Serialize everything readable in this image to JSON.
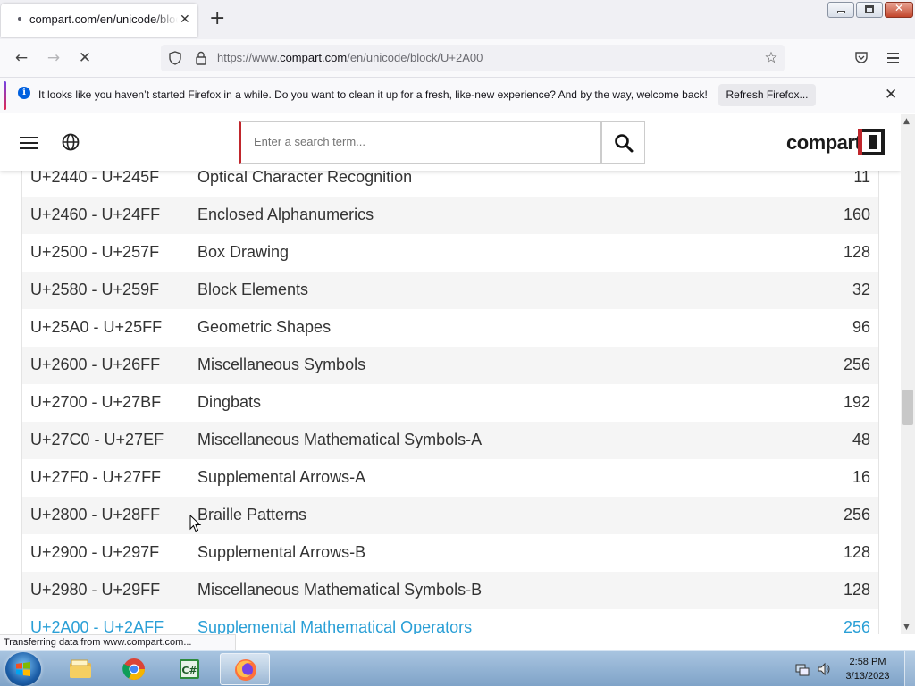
{
  "browser": {
    "tab_title": "compart.com/en/unicode/block/U+2A00",
    "url_prefix": "https://www.",
    "url_host": "compart.com",
    "url_path": "/en/unicode/block/U+2A00",
    "notification": "It looks like you haven’t started Firefox in a while. Do you want to clean it up for a fresh, like-new experience? And by the way, welcome back!",
    "refresh_label": "Refresh Firefox...",
    "status_text": "Transferring data from www.compart.com..."
  },
  "site": {
    "logo_text": "compart",
    "search_placeholder": "Enter a search term..."
  },
  "blocks": [
    {
      "range": "U+2440 - U+245F",
      "name": "Optical Character Recognition",
      "count": "11"
    },
    {
      "range": "U+2460 - U+24FF",
      "name": "Enclosed Alphanumerics",
      "count": "160"
    },
    {
      "range": "U+2500 - U+257F",
      "name": "Box Drawing",
      "count": "128"
    },
    {
      "range": "U+2580 - U+259F",
      "name": "Block Elements",
      "count": "32"
    },
    {
      "range": "U+25A0 - U+25FF",
      "name": "Geometric Shapes",
      "count": "96"
    },
    {
      "range": "U+2600 - U+26FF",
      "name": "Miscellaneous Symbols",
      "count": "256"
    },
    {
      "range": "U+2700 - U+27BF",
      "name": "Dingbats",
      "count": "192"
    },
    {
      "range": "U+27C0 - U+27EF",
      "name": "Miscellaneous Mathematical Symbols-A",
      "count": "48"
    },
    {
      "range": "U+27F0 - U+27FF",
      "name": "Supplemental Arrows-A",
      "count": "16"
    },
    {
      "range": "U+2800 - U+28FF",
      "name": "Braille Patterns",
      "count": "256"
    },
    {
      "range": "U+2900 - U+297F",
      "name": "Supplemental Arrows-B",
      "count": "128"
    },
    {
      "range": "U+2980 - U+29FF",
      "name": "Miscellaneous Mathematical Symbols-B",
      "count": "128"
    },
    {
      "range": "U+2A00 - U+2AFF",
      "name": "Supplemental Mathematical Operators",
      "count": "256"
    }
  ],
  "taskbar": {
    "time": "2:58 PM",
    "date": "3/13/2023",
    "items": [
      "file-explorer",
      "chrome",
      "csharp",
      "firefox"
    ]
  },
  "colors": {
    "link_active": "#2a9fd6",
    "brand_red": "#c0262c"
  }
}
